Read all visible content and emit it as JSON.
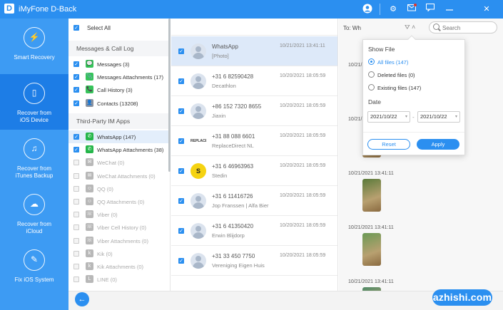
{
  "app": {
    "title": "iMyFone D-Back",
    "logo_letter": "D"
  },
  "titlebar_icons": [
    "user-icon",
    "gear-icon",
    "mail-icon",
    "feedback-icon",
    "minimize-icon",
    "close-icon"
  ],
  "sidebar": {
    "items": [
      {
        "label": "Smart Recovery",
        "icon": "lightning-icon",
        "active": false
      },
      {
        "label": "Recover from\niOS Device",
        "icon": "phone-icon",
        "active": true
      },
      {
        "label": "Recover from\niTunes Backup",
        "icon": "music-icon",
        "active": false
      },
      {
        "label": "Recover from\niCloud",
        "icon": "cloud-icon",
        "active": false
      },
      {
        "label": "Fix iOS System",
        "icon": "wrench-icon",
        "active": false
      }
    ]
  },
  "categories": {
    "select_all": "Select All",
    "groups": [
      {
        "title": "Messages & Call Log"
      },
      {
        "title": "Third-Party IM Apps"
      }
    ],
    "group1": [
      {
        "label": "Messages (3)",
        "color": "#36c35a",
        "glyph": "💬",
        "checked": true
      },
      {
        "label": "Messages Attachments (17)",
        "color": "#36c35a",
        "glyph": "📎",
        "checked": true
      },
      {
        "label": "Call History (3)",
        "color": "#36c35a",
        "glyph": "📞",
        "checked": true
      },
      {
        "label": "Contacts (13208)",
        "color": "#8b93a0",
        "glyph": "👤",
        "checked": true
      }
    ],
    "group2": [
      {
        "label": "WhatsApp (147)",
        "color": "#25b64a",
        "glyph": "✆",
        "checked": true,
        "selected": true
      },
      {
        "label": "WhatsApp Attachments (38)",
        "color": "#25b64a",
        "glyph": "✆",
        "checked": true
      },
      {
        "label": "WeChat (0)",
        "color": "#b8b8b8",
        "glyph": "✉",
        "checked": false
      },
      {
        "label": "WeChat Attachments (0)",
        "color": "#b8b8b8",
        "glyph": "✉",
        "checked": false
      },
      {
        "label": "QQ (0)",
        "color": "#b8b8b8",
        "glyph": "☺",
        "checked": false
      },
      {
        "label": "QQ Attachments (0)",
        "color": "#b8b8b8",
        "glyph": "☺",
        "checked": false
      },
      {
        "label": "Viber (0)",
        "color": "#b8b8b8",
        "glyph": "☏",
        "checked": false
      },
      {
        "label": "Viber Cell History (0)",
        "color": "#b8b8b8",
        "glyph": "☏",
        "checked": false
      },
      {
        "label": "Viber Attachments (0)",
        "color": "#b8b8b8",
        "glyph": "☏",
        "checked": false
      },
      {
        "label": "Kik (0)",
        "color": "#b8b8b8",
        "glyph": "k",
        "checked": false
      },
      {
        "label": "Kik Attachments (0)",
        "color": "#b8b8b8",
        "glyph": "k",
        "checked": false
      },
      {
        "label": "LINE (0)",
        "color": "#b8b8b8",
        "glyph": "L",
        "checked": false
      }
    ]
  },
  "messages": [
    {
      "name": "WhatsApp",
      "sub": "[Photo]",
      "date": "10/21/2021 13:41:11",
      "avatar": "person",
      "selected": true
    },
    {
      "name": "+31 6 82590428",
      "sub": "Decathlon",
      "date": "10/20/2021 18:05:59",
      "avatar": "person"
    },
    {
      "name": "+86 152 7320 8655",
      "sub": "Jiaxin",
      "date": "10/20/2021 18:05:59",
      "avatar": "person"
    },
    {
      "name": "+31 88 088 6601",
      "sub": "ReplaceDirect NL",
      "date": "10/20/2021 18:05:59",
      "avatar": "logo",
      "avatar_text": "REPLACE DIRECT"
    },
    {
      "name": "+31 6 46963963",
      "sub": "Stedin",
      "date": "10/20/2021 18:05:59",
      "avatar": "yellow",
      "avatar_text": "S"
    },
    {
      "name": "+31 6 11416726",
      "sub": "Jop Franssen | Alfa Bier",
      "date": "10/20/2021 18:05:59",
      "avatar": "person"
    },
    {
      "name": "+31 6 41350420",
      "sub": "Erwin Blijdorp",
      "date": "10/20/2021 18:05:59",
      "avatar": "person"
    },
    {
      "name": "+31 33 450 7750",
      "sub": "Vereniging Eigen Huis",
      "date": "10/20/2021 18:05:59",
      "avatar": "person"
    }
  ],
  "detail": {
    "to_label": "To: Wh",
    "dates": [
      "10/21/2021 13:41:11",
      "10/21/2021 13:41:11",
      "10/21/2021 13:41:11",
      "10/21/2021 13:41:11",
      "10/21/2021 13:41:11"
    ],
    "photo_colors": [
      "#6b7d4a",
      "#7d8a5a",
      "#5a7a3a",
      "#6a9a55",
      "#4f8a66"
    ]
  },
  "filter": {
    "show_file_label": "Show File",
    "options": [
      {
        "label": "All files (147)",
        "selected": true
      },
      {
        "label": "Deleted files (0)",
        "selected": false
      },
      {
        "label": "Existing files (147)",
        "selected": false
      }
    ],
    "date_label": "Date",
    "date_from": "2021/10/22",
    "date_to": "2021/10/22",
    "date_sep": "-",
    "reset_label": "Reset",
    "apply_label": "Apply"
  },
  "search": {
    "placeholder": "Search"
  },
  "bottom": {
    "back_icon": "←",
    "watermark": "azhishi.com"
  }
}
